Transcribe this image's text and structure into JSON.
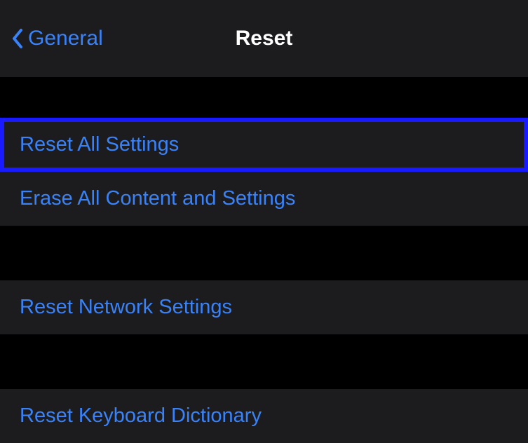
{
  "nav": {
    "back_label": "General",
    "title": "Reset"
  },
  "groups": [
    {
      "items": [
        {
          "label": "Reset All Settings",
          "highlighted": true
        },
        {
          "label": "Erase All Content and Settings",
          "highlighted": false
        }
      ]
    },
    {
      "items": [
        {
          "label": "Reset Network Settings",
          "highlighted": false
        }
      ]
    },
    {
      "items": [
        {
          "label": "Reset Keyboard Dictionary",
          "highlighted": false
        }
      ]
    }
  ],
  "colors": {
    "tint": "#3a82f7",
    "highlight_border": "#1a1aff",
    "cell_bg": "#1c1c1e"
  }
}
